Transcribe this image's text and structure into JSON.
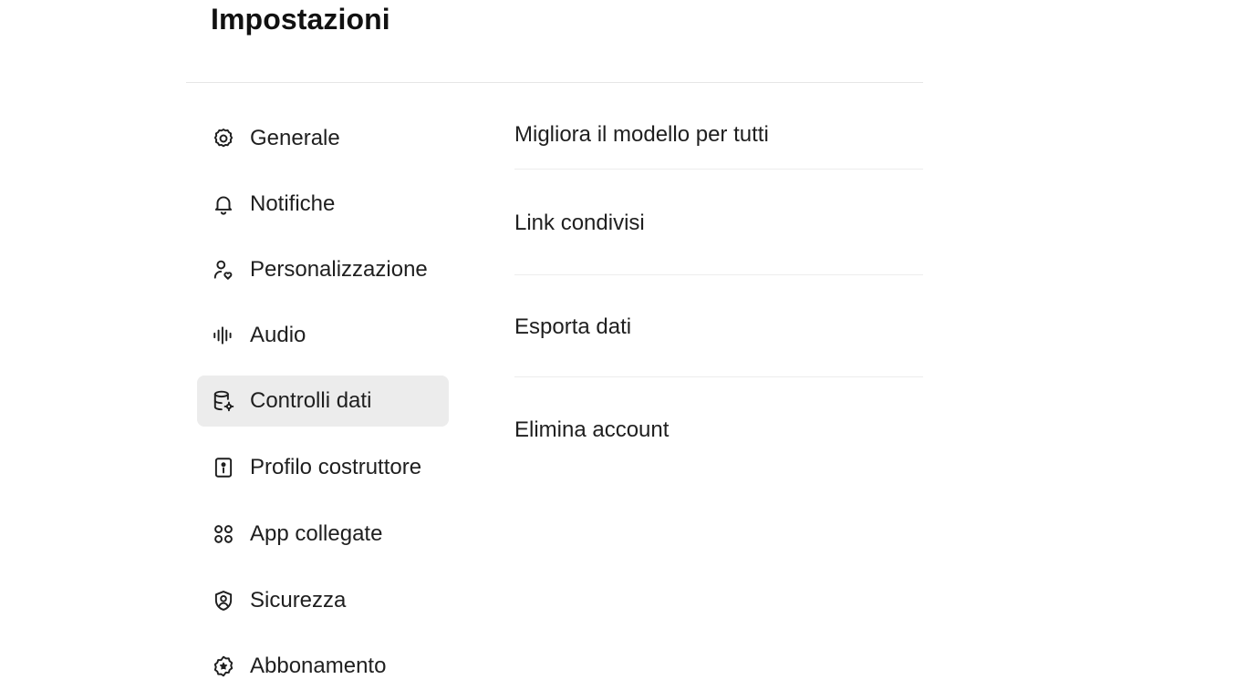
{
  "header": {
    "title": "Impostazioni"
  },
  "sidebar": {
    "items": [
      {
        "label": "Generale",
        "icon": "gear-icon"
      },
      {
        "label": "Notifiche",
        "icon": "bell-icon"
      },
      {
        "label": "Personalizzazione",
        "icon": "user-heart-icon"
      },
      {
        "label": "Audio",
        "icon": "audio-wave-icon"
      },
      {
        "label": "Controlli dati",
        "icon": "database-gear-icon",
        "active": true
      },
      {
        "label": "Profilo costruttore",
        "icon": "id-card-icon"
      },
      {
        "label": "App collegate",
        "icon": "apps-grid-icon"
      },
      {
        "label": "Sicurezza",
        "icon": "shield-user-icon"
      },
      {
        "label": "Abbonamento",
        "icon": "badge-icon"
      }
    ]
  },
  "content": {
    "rows": [
      {
        "label": "Migliora il modello per tutti"
      },
      {
        "label": "Link condivisi"
      },
      {
        "label": "Esporta dati"
      },
      {
        "label": "Elimina account"
      }
    ]
  },
  "colors": {
    "active_item_bg": "#ececec",
    "divider": "#e6e6e6",
    "text": "#1f1f1f"
  }
}
